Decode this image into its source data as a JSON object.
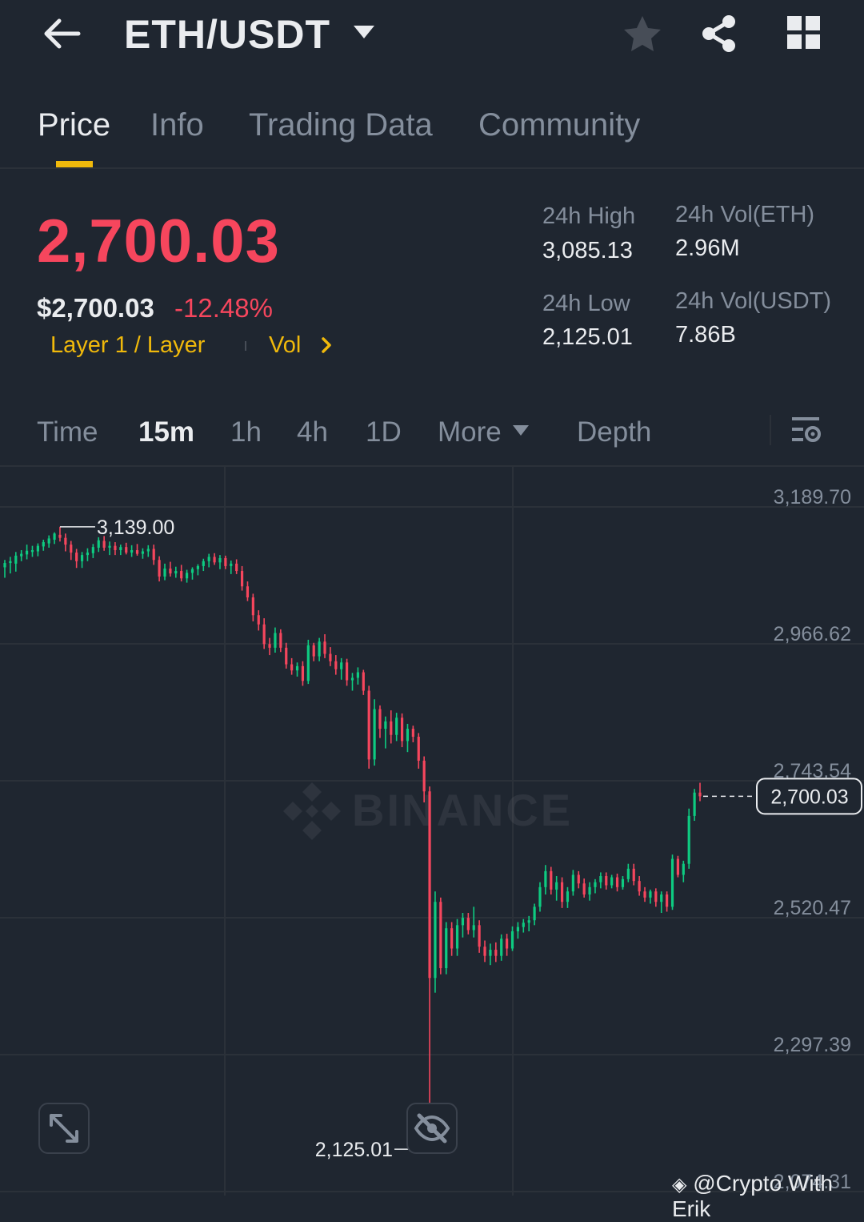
{
  "header": {
    "pair": "ETH/USDT",
    "icons": [
      "back-arrow-icon",
      "caret-down-icon",
      "star-icon",
      "share-icon",
      "grid-icon"
    ]
  },
  "tabs": [
    {
      "label": "Price",
      "active": true
    },
    {
      "label": "Info",
      "active": false
    },
    {
      "label": "Trading Data",
      "active": false
    },
    {
      "label": "Community",
      "active": false
    }
  ],
  "ticker": {
    "last_price": "2,700.03",
    "usd_price": "$2,700.03",
    "change_pct": "-12.48%",
    "tag_1": "Layer 1 / Layer",
    "tag_2": "Vol",
    "high_label": "24h High",
    "high_value": "3,085.13",
    "low_label": "24h Low",
    "low_value": "2,125.01",
    "vol_eth_label": "24h Vol(ETH)",
    "vol_eth_value": "2.96M",
    "vol_usdt_label": "24h Vol(USDT)",
    "vol_usdt_value": "7.86B"
  },
  "intervals": {
    "time": "Time",
    "m15": "15m",
    "h1": "1h",
    "h4": "4h",
    "d1": "1D",
    "more": "More",
    "depth": "Depth",
    "active": "15m"
  },
  "colors": {
    "up": "#0ecb81",
    "down": "#f6465d",
    "accent": "#f0b90b",
    "bg": "#1f2630",
    "grid": "#2b3139",
    "muted": "#848e9c"
  },
  "chart_data": {
    "type": "candlestick",
    "y_axis_labels": [
      "3,189.70",
      "2,966.62",
      "2,743.54",
      "2,520.47",
      "2,297.39",
      "2,074.31"
    ],
    "ylim": [
      2074.31,
      3189.7
    ],
    "high_marker": "3,139.00",
    "low_marker": "2,125.01",
    "last_price_label": "2,700.03",
    "last_price": 2700.03,
    "watermark": "BINANCE",
    "credit": "@Crypto With Erik",
    "candles": [
      {
        "o": 3073,
        "h": 3085,
        "l": 3056,
        "c": 3080
      },
      {
        "o": 3080,
        "h": 3090,
        "l": 3063,
        "c": 3083
      },
      {
        "o": 3079,
        "h": 3098,
        "l": 3066,
        "c": 3092
      },
      {
        "o": 3091,
        "h": 3101,
        "l": 3083,
        "c": 3095
      },
      {
        "o": 3094,
        "h": 3110,
        "l": 3086,
        "c": 3100
      },
      {
        "o": 3098,
        "h": 3108,
        "l": 3090,
        "c": 3101
      },
      {
        "o": 3099,
        "h": 3112,
        "l": 3091,
        "c": 3108
      },
      {
        "o": 3107,
        "h": 3118,
        "l": 3100,
        "c": 3114
      },
      {
        "o": 3112,
        "h": 3125,
        "l": 3105,
        "c": 3120
      },
      {
        "o": 3118,
        "h": 3130,
        "l": 3111,
        "c": 3128
      },
      {
        "o": 3126,
        "h": 3139,
        "l": 3115,
        "c": 3121
      },
      {
        "o": 3121,
        "h": 3128,
        "l": 3099,
        "c": 3110
      },
      {
        "o": 3110,
        "h": 3116,
        "l": 3085,
        "c": 3097
      },
      {
        "o": 3097,
        "h": 3103,
        "l": 3072,
        "c": 3083
      },
      {
        "o": 3083,
        "h": 3098,
        "l": 3072,
        "c": 3093
      },
      {
        "o": 3093,
        "h": 3104,
        "l": 3083,
        "c": 3097
      },
      {
        "o": 3096,
        "h": 3111,
        "l": 3088,
        "c": 3106
      },
      {
        "o": 3105,
        "h": 3122,
        "l": 3098,
        "c": 3117
      },
      {
        "o": 3116,
        "h": 3124,
        "l": 3100,
        "c": 3105
      },
      {
        "o": 3105,
        "h": 3115,
        "l": 3093,
        "c": 3108
      },
      {
        "o": 3108,
        "h": 3114,
        "l": 3093,
        "c": 3101
      },
      {
        "o": 3101,
        "h": 3110,
        "l": 3093,
        "c": 3106
      },
      {
        "o": 3106,
        "h": 3113,
        "l": 3094,
        "c": 3097
      },
      {
        "o": 3097,
        "h": 3109,
        "l": 3090,
        "c": 3101
      },
      {
        "o": 3101,
        "h": 3111,
        "l": 3092,
        "c": 3095
      },
      {
        "o": 3095,
        "h": 3104,
        "l": 3087,
        "c": 3099
      },
      {
        "o": 3099,
        "h": 3109,
        "l": 3090,
        "c": 3103
      },
      {
        "o": 3103,
        "h": 3110,
        "l": 3077,
        "c": 3085
      },
      {
        "o": 3085,
        "h": 3091,
        "l": 3050,
        "c": 3058
      },
      {
        "o": 3058,
        "h": 3079,
        "l": 3052,
        "c": 3071
      },
      {
        "o": 3071,
        "h": 3082,
        "l": 3058,
        "c": 3063
      },
      {
        "o": 3063,
        "h": 3074,
        "l": 3056,
        "c": 3067
      },
      {
        "o": 3067,
        "h": 3077,
        "l": 3050,
        "c": 3055
      },
      {
        "o": 3055,
        "h": 3069,
        "l": 3048,
        "c": 3064
      },
      {
        "o": 3064,
        "h": 3073,
        "l": 3053,
        "c": 3070
      },
      {
        "o": 3070,
        "h": 3078,
        "l": 3060,
        "c": 3075
      },
      {
        "o": 3075,
        "h": 3087,
        "l": 3067,
        "c": 3083
      },
      {
        "o": 3083,
        "h": 3095,
        "l": 3073,
        "c": 3090
      },
      {
        "o": 3090,
        "h": 3096,
        "l": 3077,
        "c": 3081
      },
      {
        "o": 3081,
        "h": 3093,
        "l": 3070,
        "c": 3088
      },
      {
        "o": 3088,
        "h": 3092,
        "l": 3070,
        "c": 3075
      },
      {
        "o": 3075,
        "h": 3084,
        "l": 3062,
        "c": 3079
      },
      {
        "o": 3079,
        "h": 3086,
        "l": 3062,
        "c": 3067
      },
      {
        "o": 3067,
        "h": 3075,
        "l": 3035,
        "c": 3042
      },
      {
        "o": 3042,
        "h": 3050,
        "l": 3018,
        "c": 3024
      },
      {
        "o": 3024,
        "h": 3030,
        "l": 2985,
        "c": 2995
      },
      {
        "o": 2995,
        "h": 3003,
        "l": 2970,
        "c": 2980
      },
      {
        "o": 2980,
        "h": 2990,
        "l": 2940,
        "c": 2948
      },
      {
        "o": 2948,
        "h": 2958,
        "l": 2930,
        "c": 2942
      },
      {
        "o": 2942,
        "h": 2975,
        "l": 2934,
        "c": 2966
      },
      {
        "o": 2966,
        "h": 2972,
        "l": 2935,
        "c": 2942
      },
      {
        "o": 2942,
        "h": 2950,
        "l": 2908,
        "c": 2915
      },
      {
        "o": 2915,
        "h": 2925,
        "l": 2898,
        "c": 2905
      },
      {
        "o": 2905,
        "h": 2918,
        "l": 2895,
        "c": 2912
      },
      {
        "o": 2912,
        "h": 2920,
        "l": 2880,
        "c": 2888
      },
      {
        "o": 2888,
        "h": 2955,
        "l": 2883,
        "c": 2946
      },
      {
        "o": 2946,
        "h": 2950,
        "l": 2920,
        "c": 2928
      },
      {
        "o": 2928,
        "h": 2958,
        "l": 2920,
        "c": 2952
      },
      {
        "o": 2952,
        "h": 2964,
        "l": 2925,
        "c": 2932
      },
      {
        "o": 2932,
        "h": 2943,
        "l": 2912,
        "c": 2920
      },
      {
        "o": 2920,
        "h": 2930,
        "l": 2898,
        "c": 2907
      },
      {
        "o": 2907,
        "h": 2925,
        "l": 2890,
        "c": 2918
      },
      {
        "o": 2918,
        "h": 2924,
        "l": 2880,
        "c": 2889
      },
      {
        "o": 2889,
        "h": 2901,
        "l": 2872,
        "c": 2893
      },
      {
        "o": 2893,
        "h": 2910,
        "l": 2882,
        "c": 2902
      },
      {
        "o": 2902,
        "h": 2906,
        "l": 2865,
        "c": 2872
      },
      {
        "o": 2872,
        "h": 2880,
        "l": 2745,
        "c": 2760
      },
      {
        "o": 2760,
        "h": 2858,
        "l": 2750,
        "c": 2842
      },
      {
        "o": 2842,
        "h": 2848,
        "l": 2795,
        "c": 2810
      },
      {
        "o": 2810,
        "h": 2830,
        "l": 2778,
        "c": 2822
      },
      {
        "o": 2822,
        "h": 2840,
        "l": 2786,
        "c": 2800
      },
      {
        "o": 2800,
        "h": 2836,
        "l": 2790,
        "c": 2828
      },
      {
        "o": 2828,
        "h": 2835,
        "l": 2780,
        "c": 2790
      },
      {
        "o": 2790,
        "h": 2818,
        "l": 2772,
        "c": 2810
      },
      {
        "o": 2810,
        "h": 2815,
        "l": 2788,
        "c": 2797
      },
      {
        "o": 2797,
        "h": 2803,
        "l": 2745,
        "c": 2758
      },
      {
        "o": 2758,
        "h": 2765,
        "l": 2690,
        "c": 2708
      },
      {
        "o": 2708,
        "h": 2716,
        "l": 2125,
        "c": 2404
      },
      {
        "o": 2404,
        "h": 2545,
        "l": 2380,
        "c": 2528
      },
      {
        "o": 2528,
        "h": 2535,
        "l": 2410,
        "c": 2420
      },
      {
        "o": 2420,
        "h": 2495,
        "l": 2410,
        "c": 2485
      },
      {
        "o": 2485,
        "h": 2495,
        "l": 2440,
        "c": 2452
      },
      {
        "o": 2452,
        "h": 2500,
        "l": 2440,
        "c": 2490
      },
      {
        "o": 2490,
        "h": 2510,
        "l": 2470,
        "c": 2502
      },
      {
        "o": 2502,
        "h": 2510,
        "l": 2475,
        "c": 2482
      },
      {
        "o": 2482,
        "h": 2520,
        "l": 2470,
        "c": 2490
      },
      {
        "o": 2490,
        "h": 2498,
        "l": 2445,
        "c": 2455
      },
      {
        "o": 2455,
        "h": 2465,
        "l": 2430,
        "c": 2440
      },
      {
        "o": 2440,
        "h": 2460,
        "l": 2425,
        "c": 2450
      },
      {
        "o": 2450,
        "h": 2462,
        "l": 2430,
        "c": 2440
      },
      {
        "o": 2440,
        "h": 2475,
        "l": 2432,
        "c": 2468
      },
      {
        "o": 2468,
        "h": 2476,
        "l": 2440,
        "c": 2452
      },
      {
        "o": 2452,
        "h": 2488,
        "l": 2448,
        "c": 2480
      },
      {
        "o": 2480,
        "h": 2495,
        "l": 2468,
        "c": 2487
      },
      {
        "o": 2487,
        "h": 2500,
        "l": 2478,
        "c": 2494
      },
      {
        "o": 2494,
        "h": 2505,
        "l": 2480,
        "c": 2498
      },
      {
        "o": 2498,
        "h": 2525,
        "l": 2490,
        "c": 2520
      },
      {
        "o": 2520,
        "h": 2560,
        "l": 2512,
        "c": 2552
      },
      {
        "o": 2552,
        "h": 2588,
        "l": 2540,
        "c": 2578
      },
      {
        "o": 2578,
        "h": 2585,
        "l": 2540,
        "c": 2548
      },
      {
        "o": 2548,
        "h": 2570,
        "l": 2530,
        "c": 2560
      },
      {
        "o": 2560,
        "h": 2568,
        "l": 2518,
        "c": 2528
      },
      {
        "o": 2528,
        "h": 2552,
        "l": 2518,
        "c": 2545
      },
      {
        "o": 2545,
        "h": 2580,
        "l": 2538,
        "c": 2572
      },
      {
        "o": 2572,
        "h": 2578,
        "l": 2550,
        "c": 2558
      },
      {
        "o": 2558,
        "h": 2566,
        "l": 2535,
        "c": 2540
      },
      {
        "o": 2540,
        "h": 2560,
        "l": 2530,
        "c": 2552
      },
      {
        "o": 2552,
        "h": 2565,
        "l": 2542,
        "c": 2560
      },
      {
        "o": 2560,
        "h": 2576,
        "l": 2550,
        "c": 2570
      },
      {
        "o": 2570,
        "h": 2576,
        "l": 2548,
        "c": 2555
      },
      {
        "o": 2555,
        "h": 2572,
        "l": 2550,
        "c": 2568
      },
      {
        "o": 2568,
        "h": 2574,
        "l": 2545,
        "c": 2552
      },
      {
        "o": 2552,
        "h": 2570,
        "l": 2548,
        "c": 2565
      },
      {
        "o": 2565,
        "h": 2590,
        "l": 2560,
        "c": 2582
      },
      {
        "o": 2582,
        "h": 2590,
        "l": 2555,
        "c": 2562
      },
      {
        "o": 2562,
        "h": 2570,
        "l": 2538,
        "c": 2545
      },
      {
        "o": 2545,
        "h": 2552,
        "l": 2528,
        "c": 2535
      },
      {
        "o": 2535,
        "h": 2548,
        "l": 2525,
        "c": 2545
      },
      {
        "o": 2545,
        "h": 2550,
        "l": 2520,
        "c": 2528
      },
      {
        "o": 2528,
        "h": 2545,
        "l": 2510,
        "c": 2540
      },
      {
        "o": 2540,
        "h": 2545,
        "l": 2512,
        "c": 2520
      },
      {
        "o": 2520,
        "h": 2605,
        "l": 2515,
        "c": 2598
      },
      {
        "o": 2598,
        "h": 2603,
        "l": 2568,
        "c": 2572
      },
      {
        "o": 2572,
        "h": 2595,
        "l": 2560,
        "c": 2590
      },
      {
        "o": 2590,
        "h": 2680,
        "l": 2582,
        "c": 2668
      },
      {
        "o": 2668,
        "h": 2712,
        "l": 2660,
        "c": 2706
      },
      {
        "o": 2706,
        "h": 2722,
        "l": 2692,
        "c": 2700
      }
    ]
  }
}
